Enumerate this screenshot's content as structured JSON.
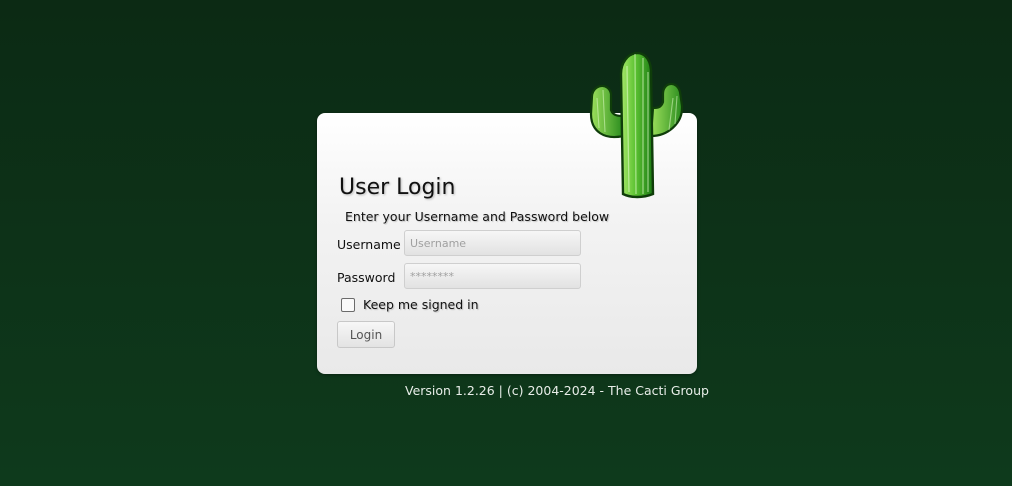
{
  "login": {
    "title": "User Login",
    "subtitle": "Enter your Username and Password below",
    "username_label": "Username",
    "username_placeholder": "Username",
    "password_label": "Password",
    "password_placeholder": "********",
    "remember_label": "Keep me signed in",
    "remember_checked": false,
    "login_button": "Login"
  },
  "footer": {
    "version": "Version 1.2.26 | (c) 2004-2024 - The Cacti Group"
  },
  "logo": {
    "icon": "cactus-logo-icon"
  },
  "colors": {
    "background": "#0e3a1c",
    "panel": "#f3f3f3",
    "cactus_light": "#8ed84a",
    "cactus_dark": "#1f8a1a"
  }
}
